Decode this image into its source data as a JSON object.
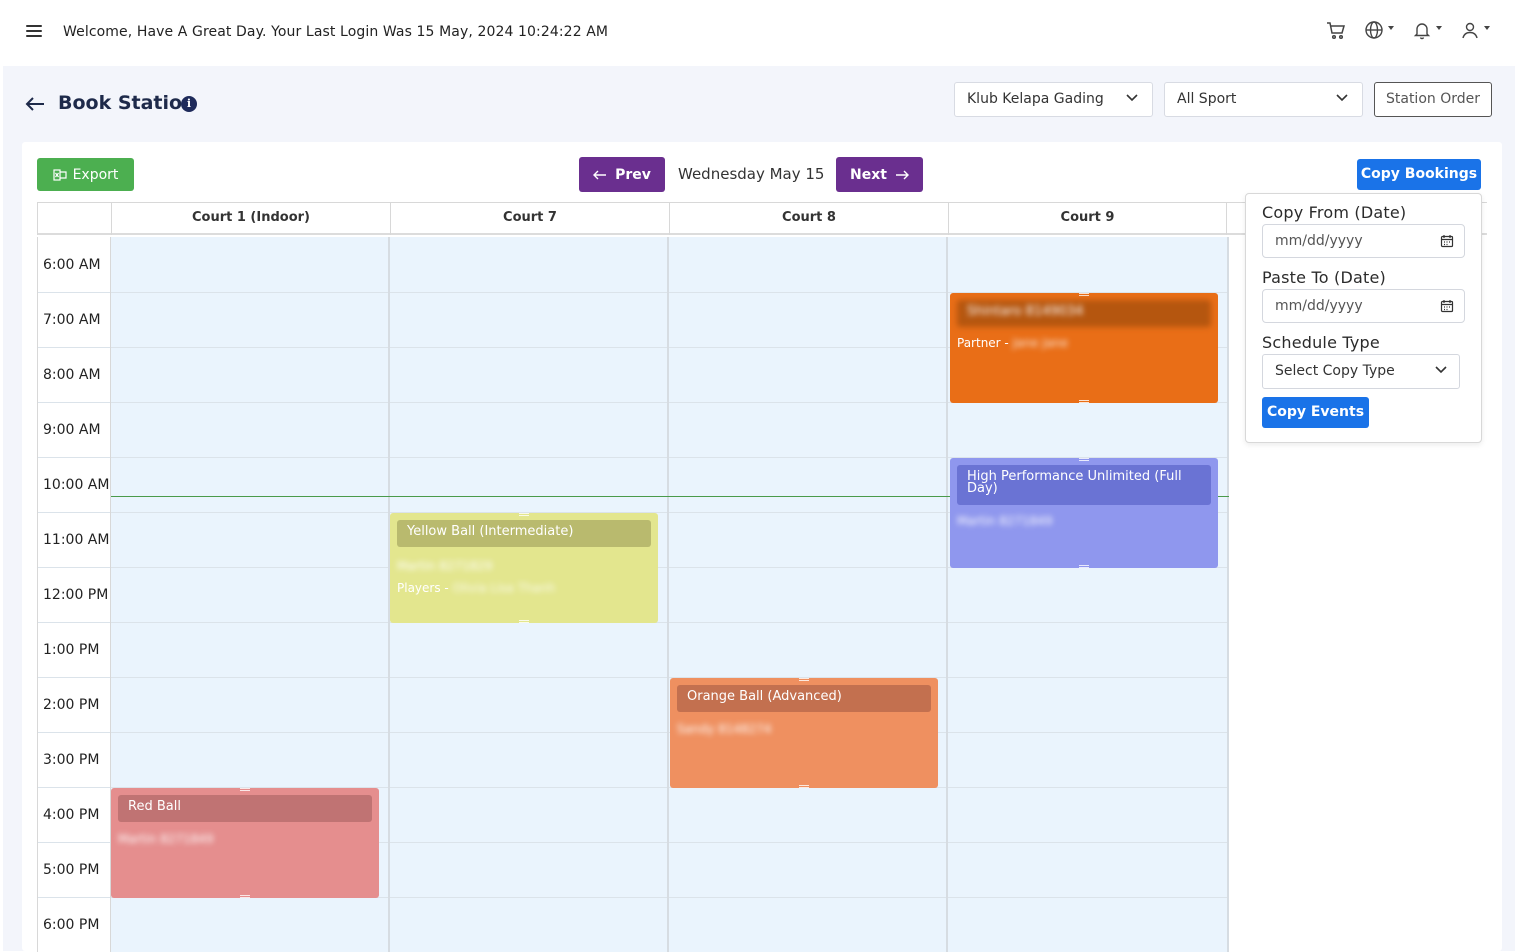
{
  "header": {
    "welcome": "Welcome, Have A Great Day. Your Last Login Was 15 May, 2024 10:24:22 AM",
    "icons": [
      "cart-icon",
      "globe-icon",
      "bell-icon",
      "user-icon"
    ]
  },
  "page": {
    "title": "Book Station",
    "info": "i",
    "club_select": "Klub Kelapa Gading",
    "sport_select": "All Sport",
    "station_order": "Station Order"
  },
  "toolbar": {
    "export": "Export",
    "prev": "Prev",
    "date": "Wednesday May 15",
    "next": "Next",
    "copy_bookings": "Copy Bookings"
  },
  "columns": [
    "Court 1 (Indoor)",
    "Court 7",
    "Court 8",
    "Court 9"
  ],
  "times": [
    "6:00 AM",
    "7:00 AM",
    "8:00 AM",
    "9:00 AM",
    "10:00 AM",
    "11:00 AM",
    "12:00 PM",
    "1:00 PM",
    "2:00 PM",
    "3:00 PM",
    "4:00 PM",
    "5:00 PM",
    "6:00 PM"
  ],
  "events": {
    "court9_early": {
      "title": "Shintaro 8149034",
      "sub_prefix": "Partner - ",
      "sub_value": "Jane Jane"
    },
    "court9_hp": {
      "title": "High Performance Unlimited (Full Day)",
      "sub": "Martin 8271849"
    },
    "court7_yellow": {
      "title": "Yellow Ball (Intermediate)",
      "sub": "Martin 8271829",
      "sub2_prefix": "Players - ",
      "sub2_value": "Olivia Lisa Thanh"
    },
    "court8_orange": {
      "title": "Orange Ball (Advanced)",
      "sub": "Sandy 8148274"
    },
    "court1_red": {
      "title": "Red Ball",
      "sub": "Martin 8271849"
    }
  },
  "colors": {
    "orange_event": "#e96e17",
    "hp_event": "#8f97ee",
    "yellow_event": "#e3e68e",
    "orange2_event": "#ef9060",
    "red_event": "#e58e8e"
  },
  "copy_panel": {
    "copy_from_label": "Copy From (Date)",
    "copy_from_placeholder": "mm/dd/yyyy",
    "paste_to_label": "Paste To (Date)",
    "paste_to_placeholder": "mm/dd/yyyy",
    "schedule_type_label": "Schedule Type",
    "schedule_type_value": "Select Copy Type",
    "copy_events": "Copy Events"
  }
}
